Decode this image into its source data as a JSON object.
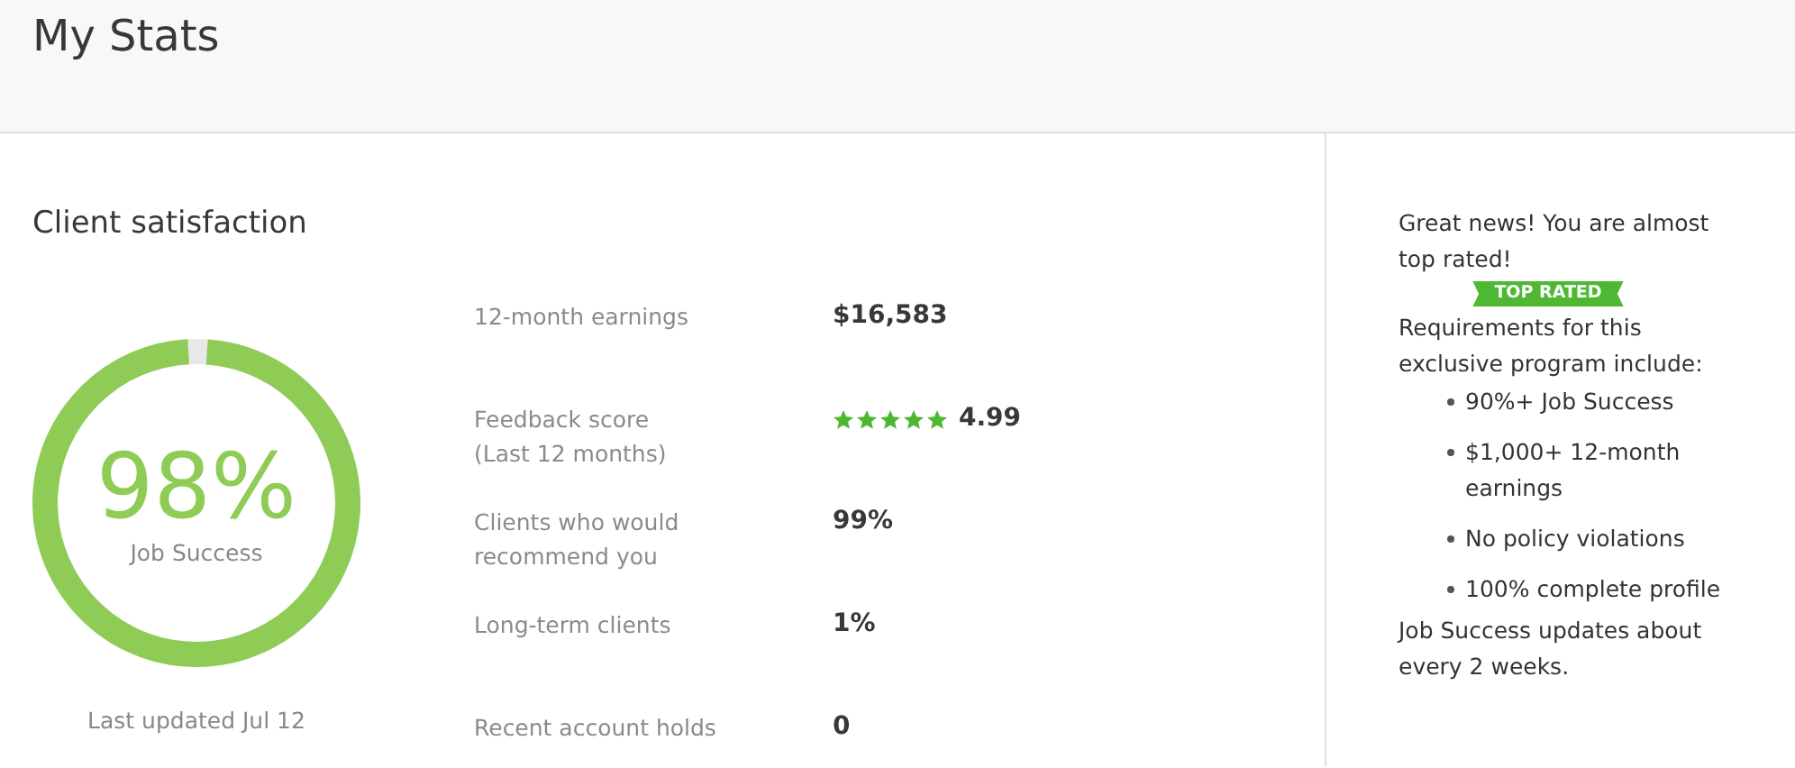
{
  "page": {
    "title": "My Stats"
  },
  "client_satisfaction": {
    "heading": "Client satisfaction",
    "job_success": {
      "value": "98%",
      "label": "Job Success",
      "level": 0.98,
      "updated": "Last updated Jul 12"
    },
    "stats": [
      {
        "kind": "text",
        "label": "12-month earnings",
        "value": "$16,583"
      },
      {
        "kind": "rating",
        "label": "Feedback score\n(Last 12 months)",
        "stars": 5,
        "value": "4.99"
      },
      {
        "kind": "text",
        "label": "Clients who would\nrecommend you",
        "value": "99%"
      },
      {
        "kind": "text",
        "label": "Long-term clients",
        "value": "1%"
      },
      {
        "kind": "text",
        "label": "Recent account holds",
        "value": "0"
      }
    ]
  },
  "sidebar": {
    "intro": "Great news! You are almost top rated!",
    "badge": "TOP RATED",
    "requirements_heading": "Requirements for this exclusive program include:",
    "requirements": [
      "90%+ Job Success",
      "$1,000+ 12-month earnings",
      "No policy violations",
      "100% complete profile"
    ],
    "note": "Job Success updates about every 2 weeks."
  }
}
